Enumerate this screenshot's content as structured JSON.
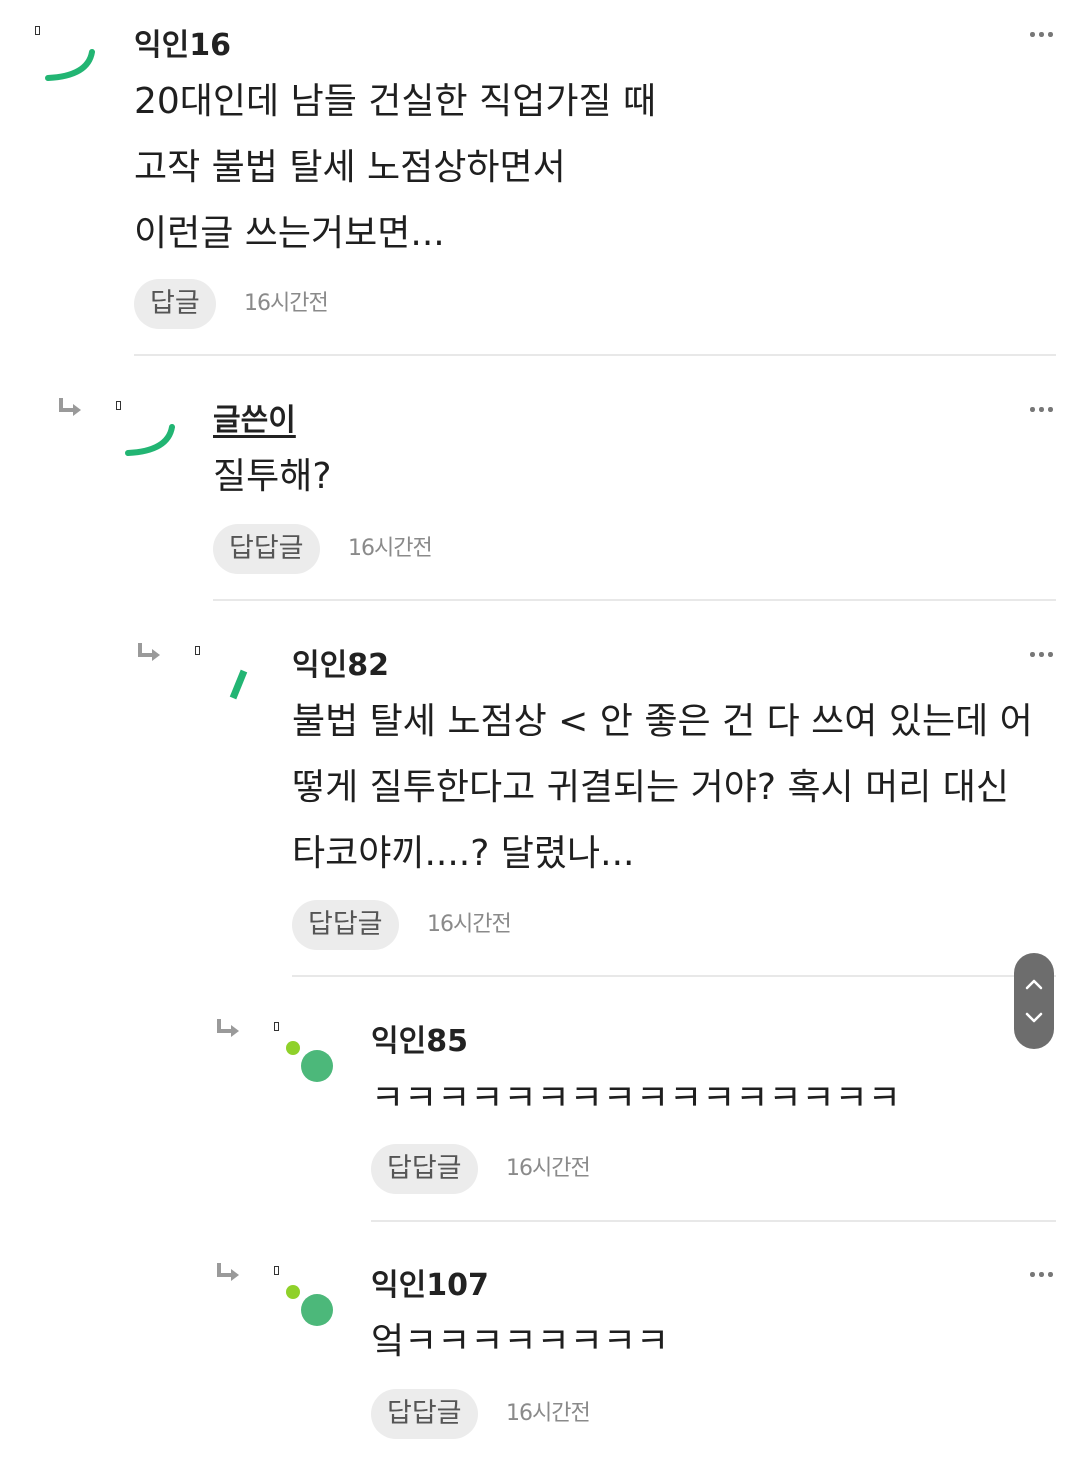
{
  "comments": [
    {
      "name": "익인16",
      "author": false,
      "lines": [
        "20대인데 남들 건실한 직업가질 때",
        "고작 불법 탈세 노점상하면서",
        "이런글 쓰는거보면..."
      ],
      "reply_label": "답글",
      "time": "16시간전",
      "avatar_icon": "green-arc-avatar-icon"
    },
    {
      "name": "글쓴이",
      "author": true,
      "lines": [
        "질투해?"
      ],
      "reply_label": "답답글",
      "time": "16시간전",
      "avatar_icon": "green-arc-avatar-icon"
    },
    {
      "name": "익인82",
      "author": false,
      "lines": [
        "불법 탈세 노점상 < 안 좋은 건 다 쓰여 있는데 어",
        "떻게 질투한다고 귀결되는 거야? 혹시 머리 대신",
        "타코야끼....? 달렸나..."
      ],
      "reply_label": "답답글",
      "time": "16시간전",
      "avatar_icon": "green-slash-avatar-icon"
    },
    {
      "name": "익인85",
      "author": false,
      "lines": [
        "ㅋㅋㅋㅋㅋㅋㅋㅋㅋㅋㅋㅋㅋㅋㅋㅋ"
      ],
      "reply_label": "답답글",
      "time": "16시간전",
      "avatar_icon": "green-dots-avatar-icon"
    },
    {
      "name": "익인107",
      "author": false,
      "lines": [
        "엌ㅋㅋㅋㅋㅋㅋㅋㅋ"
      ],
      "reply_label": "답답글",
      "time": "16시간전",
      "avatar_icon": "green-dots-avatar-icon"
    }
  ],
  "colors": {
    "accent_green": "#22b573",
    "lime_green": "#8fd12a",
    "dot_green": "#4cb87a",
    "button_bg": "#ececec",
    "divider": "#e8e8e8",
    "scroll_pill": "#6d6d6d"
  },
  "icons": {
    "reply_arrow": "reply-arrow-icon",
    "more": "more-options-icon",
    "scroll_up": "chevron-up-icon",
    "scroll_down": "chevron-down-icon"
  }
}
